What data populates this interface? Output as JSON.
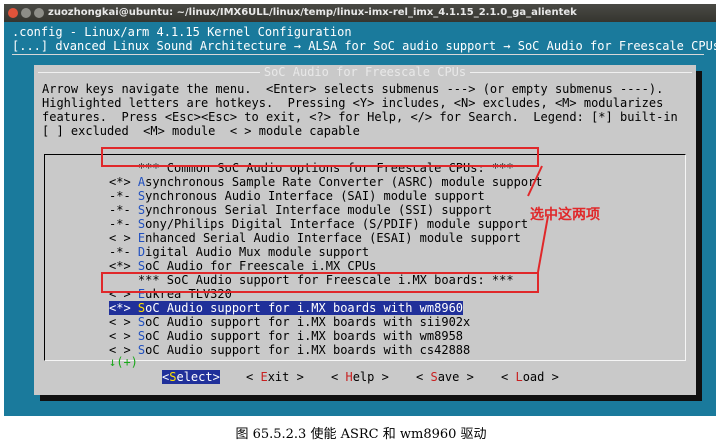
{
  "window": {
    "title": "zuozhongkai@ubuntu: ~/linux/IMX6ULL/linux/temp/linux-imx-rel_imx_4.1.15_2.1.0_ga_alientek"
  },
  "header": {
    "line1": ".config - Linux/arm 4.1.15 Kernel Configuration",
    "line2": "[...] dvanced Linux Sound Architecture → ALSA for SoC audio support → SoC Audio for Freescale CPUs"
  },
  "dialog": {
    "title": "SoC Audio for Freescale CPUs",
    "help_lines": [
      "Arrow keys navigate the menu.  <Enter> selects submenus ---> (or empty submenus ----).",
      "Highlighted letters are hotkeys.  Pressing <Y> includes, <N> excludes, <M> modularizes",
      "features.  Press <Esc><Esc> to exit, <?> for Help, </> for Search.  Legend: [*] built-in",
      "[ ] excluded  <M> module  < > module capable"
    ]
  },
  "menu": {
    "items": [
      {
        "prefix": "    ",
        "hot": "",
        "rest": "*** Common SoC Audio options for Freescale CPUs: ***"
      },
      {
        "prefix": "<*> ",
        "hot": "A",
        "rest": "synchronous Sample Rate Converter (ASRC) module support"
      },
      {
        "prefix": "-*- ",
        "hot": "S",
        "rest": "ynchronous Audio Interface (SAI) module support"
      },
      {
        "prefix": "-*- ",
        "hot": "S",
        "rest": "ynchronous Serial Interface module (SSI) support"
      },
      {
        "prefix": "-*- ",
        "hot": "S",
        "rest": "ony/Philips Digital Interface (S/PDIF) module support"
      },
      {
        "prefix": "< > ",
        "hot": "E",
        "rest": "nhanced Serial Audio Interface (ESAI) module support"
      },
      {
        "prefix": "-*- ",
        "hot": "D",
        "rest": "igital Audio Mux module support"
      },
      {
        "prefix": "<*> ",
        "hot": "S",
        "rest": "oC Audio for Freescale i.MX CPUs"
      },
      {
        "prefix": "    ",
        "hot": "",
        "rest": "*** SoC Audio support for Freescale i.MX boards: ***"
      },
      {
        "prefix": "< > ",
        "hot": "E",
        "rest": "ukrea TLV320"
      },
      {
        "prefix": "<*> ",
        "hot": "S",
        "rest": "oC Audio support for i.MX boards with wm8960"
      },
      {
        "prefix": "< > ",
        "hot": "S",
        "rest": "oC Audio support for i.MX boards with sii902x"
      },
      {
        "prefix": "< > ",
        "hot": "S",
        "rest": "oC Audio support for i.MX boards with wm8958"
      },
      {
        "prefix": "< > ",
        "hot": "S",
        "rest": "oC Audio support for i.MX boards with cs42888"
      }
    ],
    "more_indicator": "↓(+)"
  },
  "buttons": [
    {
      "pre": "<",
      "hot": "S",
      "rest": "elect>"
    },
    {
      "pre": "< ",
      "hot": "E",
      "rest": "xit >"
    },
    {
      "pre": "< ",
      "hot": "H",
      "rest": "elp >"
    },
    {
      "pre": "< ",
      "hot": "S",
      "rest": "ave >"
    },
    {
      "pre": "< ",
      "hot": "L",
      "rest": "oad >"
    }
  ],
  "annotation": {
    "text": "选中这两项",
    "color": "#e0282a"
  },
  "caption": "图 65.5.2.3 使能 ASRC 和 wm8960 驱动",
  "colors": {
    "terminal_bg": "#1a7a9c",
    "dialog_bg": "#c9c9c9",
    "selection_bg": "#20309a",
    "hotkey": "#2050c0"
  }
}
